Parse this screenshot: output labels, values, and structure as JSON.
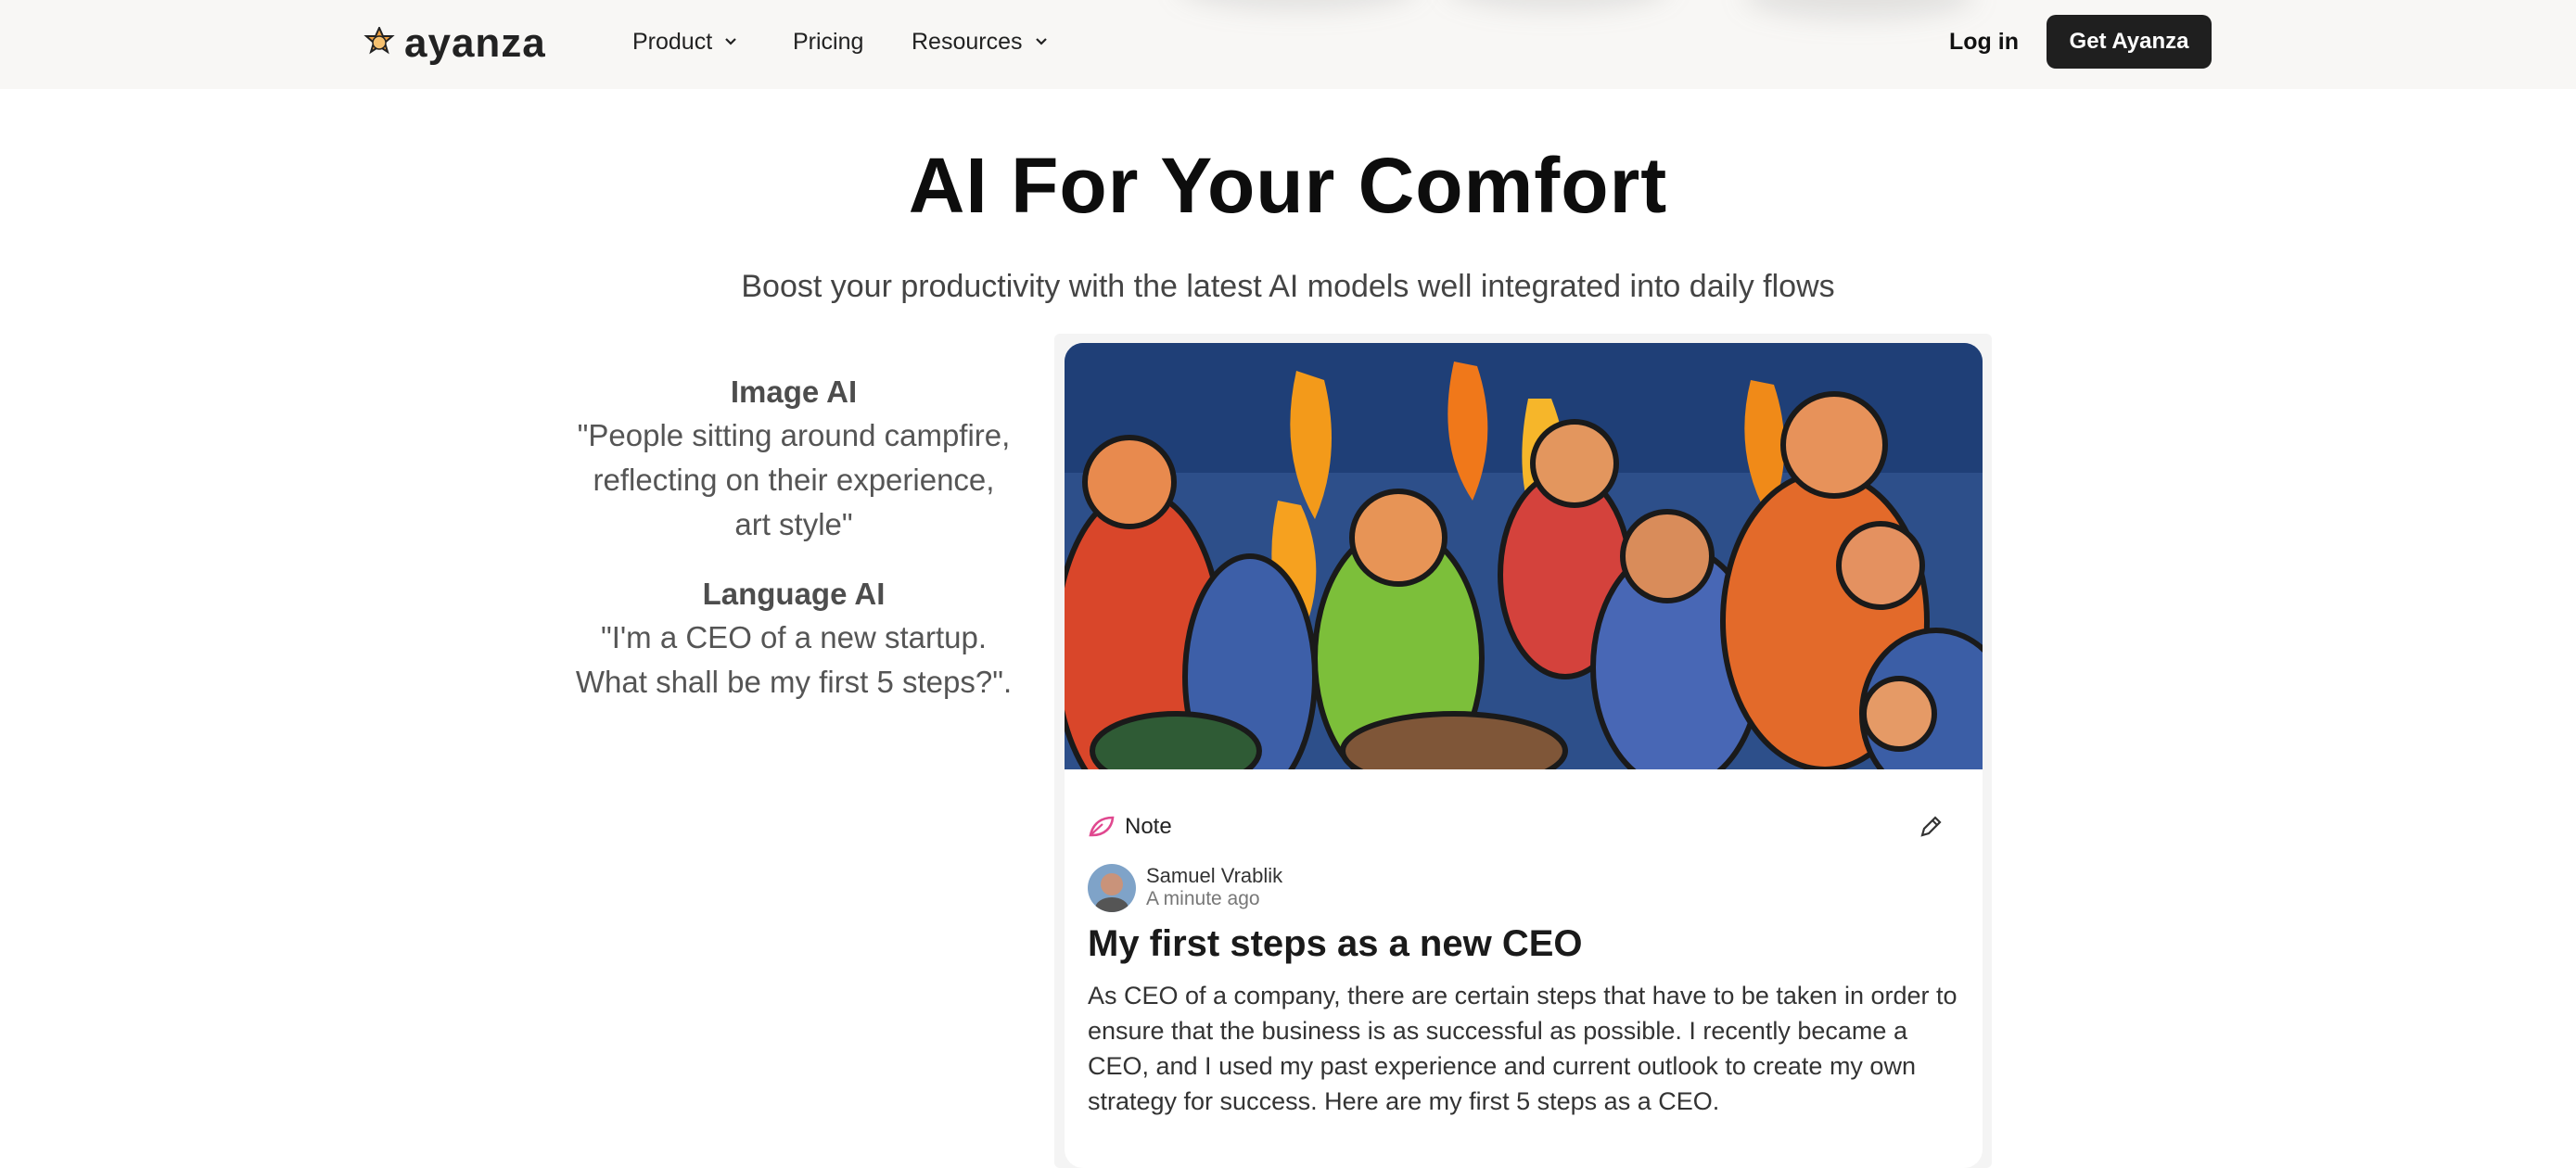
{
  "nav": {
    "logo_text": "ayanza",
    "menu": [
      {
        "label": "Product",
        "has_dropdown": true
      },
      {
        "label": "Pricing",
        "has_dropdown": false
      },
      {
        "label": "Resources",
        "has_dropdown": true
      }
    ],
    "login_label": "Log in",
    "cta_label": "Get Ayanza"
  },
  "hero": {
    "title": "AI For Your Comfort",
    "subtitle": "Boost your productivity with the latest AI models well integrated into daily flows"
  },
  "prompts": [
    {
      "heading": "Image AI",
      "text": "\"People sitting around campfire, reflecting on their experience, art style\""
    },
    {
      "heading": "Language AI",
      "text": "\"I'm a CEO of a new startup. What shall be my first 5 steps?\"."
    }
  ],
  "card": {
    "note_label": "Note",
    "author": "Samuel Vrablik",
    "time": "A minute ago",
    "post_title": "My first steps as a new CEO",
    "post_body": "As CEO of a company, there are certain steps that have to be taken in order to ensure that the business is as successful as possible. I recently became a CEO, and I used my past experience and current outlook to create my own strategy for success. Here are my first 5 steps as a CEO."
  },
  "colors": {
    "nav_bg": "#f8f7f5",
    "cta_bg": "#1f1f1f",
    "note_icon": "#e0488f",
    "logo_accent": "#f0a040"
  },
  "icons": [
    "ayanza-logo-icon",
    "chevron-down-icon",
    "note-leaf-icon",
    "pencil-edit-icon"
  ]
}
